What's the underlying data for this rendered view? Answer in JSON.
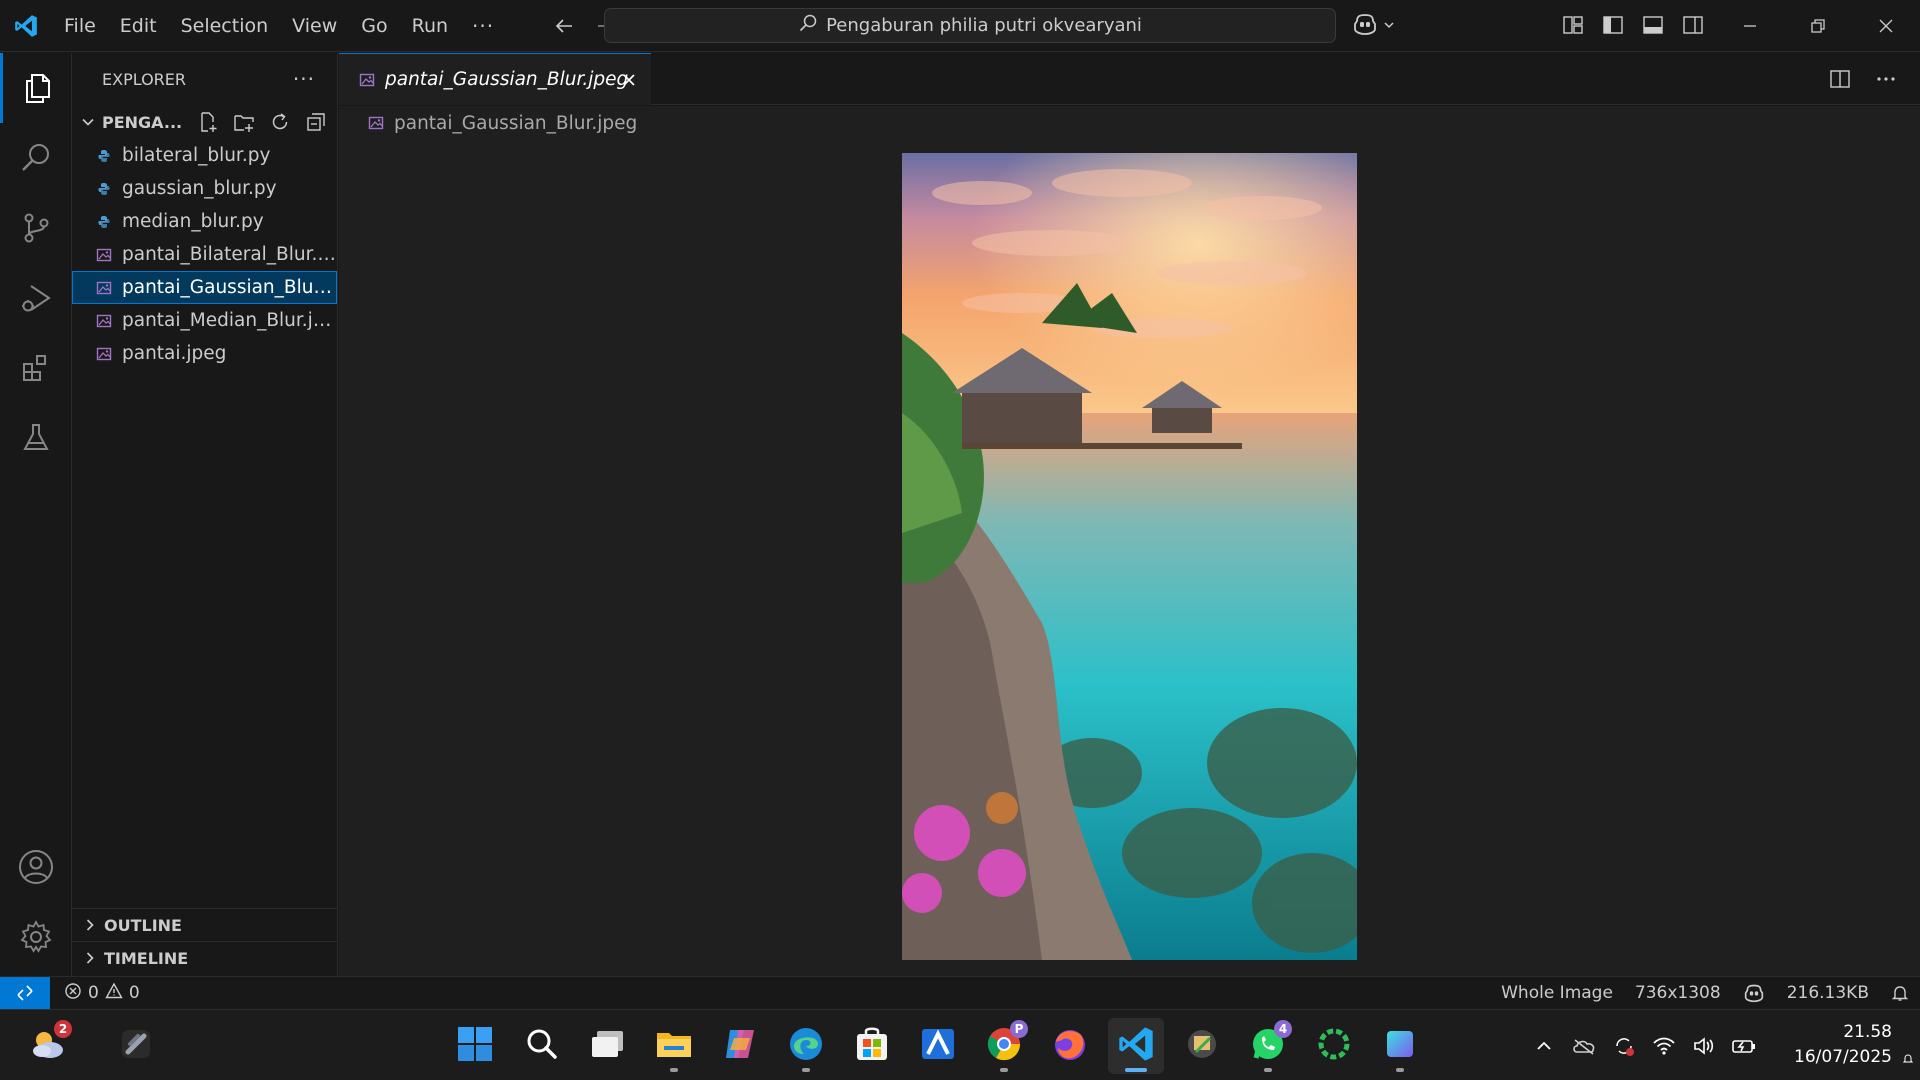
{
  "titlebar": {
    "menu": [
      "File",
      "Edit",
      "Selection",
      "View",
      "Go",
      "Run"
    ],
    "more": "···",
    "command_center": "Pengaburan philia putri okvearyani"
  },
  "explorer": {
    "title": "EXPLORER",
    "more": "···",
    "folder": "PENGA...",
    "files": [
      {
        "name": "bilateral_blur.py",
        "type": "python"
      },
      {
        "name": "gaussian_blur.py",
        "type": "python"
      },
      {
        "name": "median_blur.py",
        "type": "python"
      },
      {
        "name": "pantai_Bilateral_Blur.jpeg",
        "type": "image"
      },
      {
        "name": "pantai_Gaussian_Blur.j...",
        "type": "image",
        "selected": true
      },
      {
        "name": "pantai_Median_Blur.jpeg",
        "type": "image"
      },
      {
        "name": "pantai.jpeg",
        "type": "image"
      }
    ],
    "outline": "OUTLINE",
    "timeline": "TIMELINE"
  },
  "editor": {
    "tab_label": "pantai_Gaussian_Blur.jpeg",
    "breadcrumb": "pantai_Gaussian_Blur.jpeg"
  },
  "statusbar": {
    "errors": "0",
    "warnings": "0",
    "zoom": "Whole Image",
    "dimensions": "736x1308",
    "size": "216.13KB"
  },
  "taskbar": {
    "weather_badge": "2",
    "chrome_badge": "P",
    "whatsapp_badge": "4",
    "time": "21.58",
    "date": "16/07/2025"
  },
  "colors": {
    "accent": "#0078d4",
    "python_icon": "#4b9cd3",
    "image_icon": "#a074c4"
  }
}
